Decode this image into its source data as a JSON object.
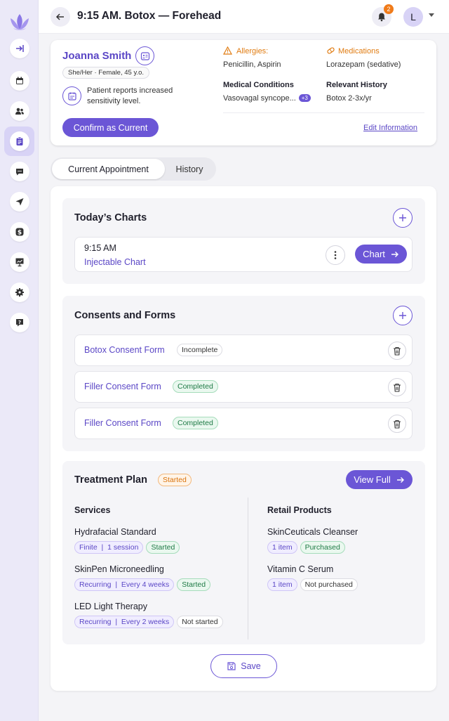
{
  "header": {
    "title": "9:15 AM. Botox — Forehead",
    "notification_count": "2",
    "avatar_initial": "L"
  },
  "patient": {
    "name": "Joanna Smith",
    "pronouns": "She/Her · Female, 45 y.o.",
    "note": "Patient reports increased sensitivity level.",
    "allergies_label": "Allergies:",
    "allergies": "Penicillin, Aspirin",
    "medications_label": "Medications",
    "medications": "Lorazepam (sedative)",
    "conditions_label": "Medical Conditions",
    "conditions": "Vasovagal syncope...",
    "conditions_more": "+3",
    "history_label": "Relevant History",
    "history": "Botox 2-3x/yr",
    "confirm_label": "Confirm as Current",
    "edit_label": "Edit Information"
  },
  "tabs": [
    {
      "label": "Current Appointment",
      "active": true
    },
    {
      "label": "History",
      "active": false
    }
  ],
  "todays_charts": {
    "title": "Today’s Charts",
    "items": [
      {
        "time": "9:15 AM",
        "type": "Injectable Chart",
        "button_label": "Chart"
      }
    ]
  },
  "consents": {
    "title": "Consents and Forms",
    "items": [
      {
        "name": "Botox Consent Form",
        "status": "Incomplete"
      },
      {
        "name": "Filler Consent Form",
        "status": "Completed"
      },
      {
        "name": "Filler Consent Form",
        "status": "Completed"
      }
    ]
  },
  "treatment_plan": {
    "title": "Treatment Plan",
    "status": "Started",
    "view_full_label": "View Full",
    "services_label": "Services",
    "products_label": "Retail Products",
    "services": [
      {
        "name": "Hydrafacial Standard",
        "frequency": "Finite  |  1 session",
        "status": "Started"
      },
      {
        "name": "SkinPen Microneedling",
        "frequency": "Recurring  |  Every 4 weeks",
        "status": "Started"
      },
      {
        "name": "LED Light Therapy",
        "frequency": "Recurring  |  Every 2 weeks",
        "status": "Not started"
      }
    ],
    "products": [
      {
        "name": "SkinCeuticals Cleanser",
        "quantity": "1 item",
        "status": "Purchased"
      },
      {
        "name": "Vitamin C Serum",
        "quantity": "1 item",
        "status": "Not purchased"
      }
    ]
  },
  "save_label": "Save",
  "colors": {
    "accent": "#6b56d6",
    "accent_text": "#5b47c6",
    "warning": "#e07b10",
    "success": "#1e7a45",
    "sidebar_bg": "#ebe9f8"
  }
}
